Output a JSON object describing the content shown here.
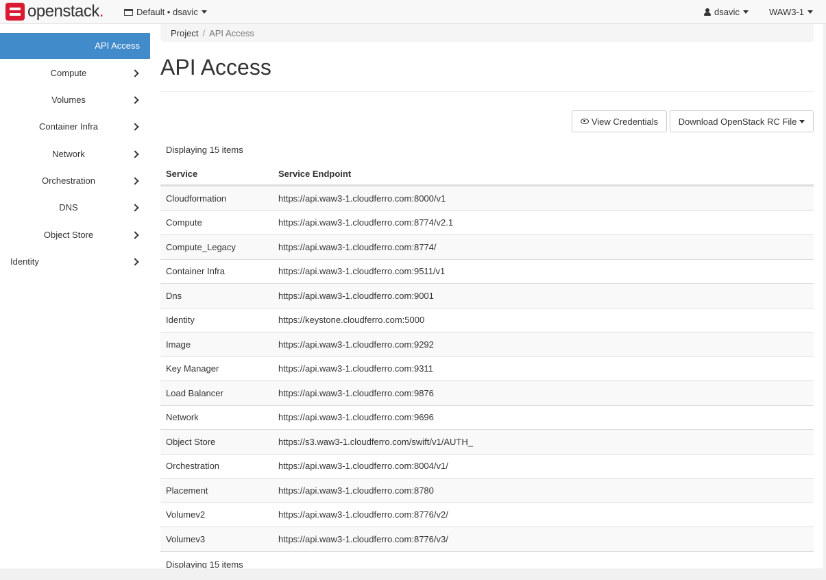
{
  "brand": {
    "name": "openstack",
    "dot": "."
  },
  "header": {
    "project_selector": "Default • dsavic",
    "user": "dsavic",
    "region": "WAW3-1"
  },
  "sidebar": {
    "active": "API Access",
    "items": [
      {
        "label": "Compute"
      },
      {
        "label": "Volumes"
      },
      {
        "label": "Container Infra"
      },
      {
        "label": "Network"
      },
      {
        "label": "Orchestration"
      },
      {
        "label": "DNS"
      },
      {
        "label": "Object Store"
      },
      {
        "label": "Identity"
      }
    ]
  },
  "breadcrumb": {
    "parent": "Project",
    "separator": "/",
    "current": "API Access"
  },
  "page": {
    "title": "API Access",
    "view_credentials": "View Credentials",
    "download_rc": "Download OpenStack RC File",
    "count_top": "Displaying 15 items",
    "count_bottom": "Displaying 15 items"
  },
  "table": {
    "columns": [
      "Service",
      "Service Endpoint"
    ],
    "rows": [
      {
        "service": "Cloudformation",
        "endpoint": "https://api.waw3-1.cloudferro.com:8000/v1"
      },
      {
        "service": "Compute",
        "endpoint": "https://api.waw3-1.cloudferro.com:8774/v2.1"
      },
      {
        "service": "Compute_Legacy",
        "endpoint": "https://api.waw3-1.cloudferro.com:8774/"
      },
      {
        "service": "Container Infra",
        "endpoint": "https://api.waw3-1.cloudferro.com:9511/v1"
      },
      {
        "service": "Dns",
        "endpoint": "https://api.waw3-1.cloudferro.com:9001"
      },
      {
        "service": "Identity",
        "endpoint": "https://keystone.cloudferro.com:5000"
      },
      {
        "service": "Image",
        "endpoint": "https://api.waw3-1.cloudferro.com:9292"
      },
      {
        "service": "Key Manager",
        "endpoint": "https://api.waw3-1.cloudferro.com:9311"
      },
      {
        "service": "Load Balancer",
        "endpoint": "https://api.waw3-1.cloudferro.com:9876"
      },
      {
        "service": "Network",
        "endpoint": "https://api.waw3-1.cloudferro.com:9696"
      },
      {
        "service": "Object Store",
        "endpoint": "https://s3.waw3-1.cloudferro.com/swift/v1/AUTH_"
      },
      {
        "service": "Orchestration",
        "endpoint": "https://api.waw3-1.cloudferro.com:8004/v1/"
      },
      {
        "service": "Placement",
        "endpoint": "https://api.waw3-1.cloudferro.com:8780"
      },
      {
        "service": "Volumev2",
        "endpoint": "https://api.waw3-1.cloudferro.com:8776/v2/"
      },
      {
        "service": "Volumev3",
        "endpoint": "https://api.waw3-1.cloudferro.com:8776/v3/"
      }
    ]
  },
  "colors": {
    "accent": "#428bca",
    "brand": "#da1a32"
  },
  "icons": [
    "openstack-logo-icon",
    "project-icon",
    "user-icon",
    "eye-icon",
    "caret-down-icon",
    "chevron-right-icon"
  ]
}
